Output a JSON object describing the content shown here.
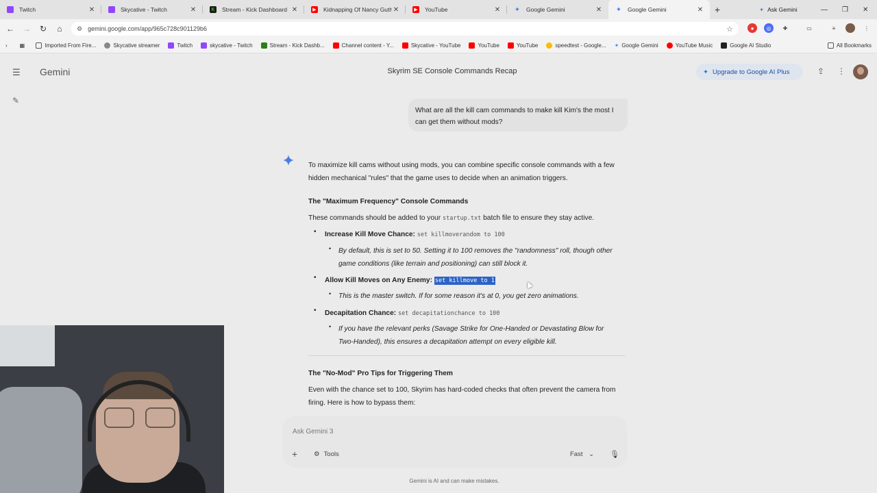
{
  "browser": {
    "tabs": [
      {
        "title": "Twitch",
        "color": "#9146ff"
      },
      {
        "title": "Skycative - Twitch",
        "color": "#9146ff"
      },
      {
        "title": "Stream - Kick Dashboard",
        "color": "#53fc18"
      },
      {
        "title": "Kidnapping Of Nancy Guthr",
        "color": "#ff0000"
      },
      {
        "title": "YouTube",
        "color": "#ff0000"
      },
      {
        "title": "Google Gemini",
        "color": "#4285f4"
      },
      {
        "title": "Google Gemini",
        "color": "#4285f4"
      }
    ],
    "ask_gemini": "Ask Gemini",
    "url": "gemini.google.com/app/965c728c901129b6",
    "bookmarks": [
      "Imported From Fire...",
      "Skycative streamer",
      "Twitch",
      "skycative - Twitch",
      "Stream - Kick Dashb...",
      "Channel content - Y...",
      "Skycative - YouTube",
      "YouTube",
      "YouTube",
      "speedtest - Google...",
      "Google Gemini",
      "YouTube Music",
      "Google AI Studio"
    ],
    "all_bookmarks": "All Bookmarks"
  },
  "app": {
    "brand": "Gemini",
    "title": "Skyrim SE Console Commands Recap",
    "upgrade": "Upgrade to Google AI Plus"
  },
  "chat": {
    "user_message": "What are all the kill cam commands to make kill Kim's the most I can get them without mods?",
    "intro": "To maximize kill cams without using mods, you can combine specific console commands with a few hidden mechanical \"rules\" that the game uses to decide when an animation triggers.",
    "heading1": "The \"Maximum Frequency\" Console Commands",
    "lead1_a": "These commands should be added to your",
    "lead1_code": "startup.txt",
    "lead1_b": "batch file to ensure they stay active.",
    "items": [
      {
        "label": "Increase Kill Move Chance:",
        "code": "set killmoverandom to 100",
        "sub": "By default, this is set to 50. Setting it to 100 removes the \"randomness\" roll, though other game conditions (like terrain and positioning) can still block it."
      },
      {
        "label": "Allow Kill Moves on Any Enemy:",
        "code": "set killmove to 1",
        "sub": "This is the master switch. If for some reason it's at 0, you get zero animations."
      },
      {
        "label": "Decapitation Chance:",
        "code": "set decapitationchance to 100",
        "sub": "If you have the relevant perks (Savage Strike for One-Handed or Devastating Blow for Two-Handed), this ensures a decapitation attempt on every eligible kill."
      }
    ],
    "heading2": "The \"No-Mod\" Pro Tips for Triggering Them",
    "lead2": "Even with the chance set to 100, Skyrim has hard-coded checks that often prevent the camera from firing. Here is how to bypass them:"
  },
  "input": {
    "placeholder": "Ask Gemini 3",
    "tools": "Tools",
    "mode": "Fast",
    "disclaimer": "Gemini is AI and can make mistakes."
  }
}
